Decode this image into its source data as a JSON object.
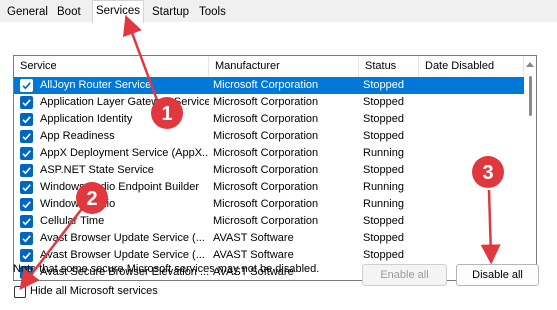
{
  "tabs": [
    "General",
    "Boot",
    "Services",
    "Startup",
    "Tools"
  ],
  "active_tab": "Services",
  "columns": [
    "Service",
    "Manufacturer",
    "Status",
    "Date Disabled"
  ],
  "rows": [
    {
      "service": "AllJoyn Router Service",
      "manufacturer": "Microsoft Corporation",
      "status": "Stopped",
      "date": "",
      "checked": true,
      "selected": true
    },
    {
      "service": "Application Layer Gateway Service",
      "manufacturer": "Microsoft Corporation",
      "status": "Stopped",
      "date": "",
      "checked": true
    },
    {
      "service": "Application Identity",
      "manufacturer": "Microsoft Corporation",
      "status": "Stopped",
      "date": "",
      "checked": true
    },
    {
      "service": "App Readiness",
      "manufacturer": "Microsoft Corporation",
      "status": "Stopped",
      "date": "",
      "checked": true
    },
    {
      "service": "AppX Deployment Service (AppX...",
      "manufacturer": "Microsoft Corporation",
      "status": "Running",
      "date": "",
      "checked": true
    },
    {
      "service": "ASP.NET State Service",
      "manufacturer": "Microsoft Corporation",
      "status": "Stopped",
      "date": "",
      "checked": true
    },
    {
      "service": "Windows Audio Endpoint Builder",
      "manufacturer": "Microsoft Corporation",
      "status": "Running",
      "date": "",
      "checked": true
    },
    {
      "service": "Windows Audio",
      "manufacturer": "Microsoft Corporation",
      "status": "Running",
      "date": "",
      "checked": true
    },
    {
      "service": "Cellular Time",
      "manufacturer": "Microsoft Corporation",
      "status": "Stopped",
      "date": "",
      "checked": true
    },
    {
      "service": "Avast Browser Update Service (...",
      "manufacturer": "AVAST Software",
      "status": "Stopped",
      "date": "",
      "checked": true
    },
    {
      "service": "Avast Browser Update Service (...",
      "manufacturer": "AVAST Software",
      "status": "Stopped",
      "date": "",
      "checked": true
    },
    {
      "service": "Avast Secure Browser Elevation ...",
      "manufacturer": "AVAST Software",
      "status": "Stopped",
      "date": "",
      "checked": true
    }
  ],
  "note": "Note that some secure Microsoft services may not be disabled.",
  "hide_label": "Hide all Microsoft services",
  "hide_checked": false,
  "buttons": {
    "enable_all": "Enable all",
    "disable_all": "Disable all"
  },
  "annotations": [
    "1",
    "2",
    "3"
  ],
  "colors": {
    "selection": "#0078d7",
    "checkbox": "#0067c0",
    "annotation": "#e0383e"
  }
}
